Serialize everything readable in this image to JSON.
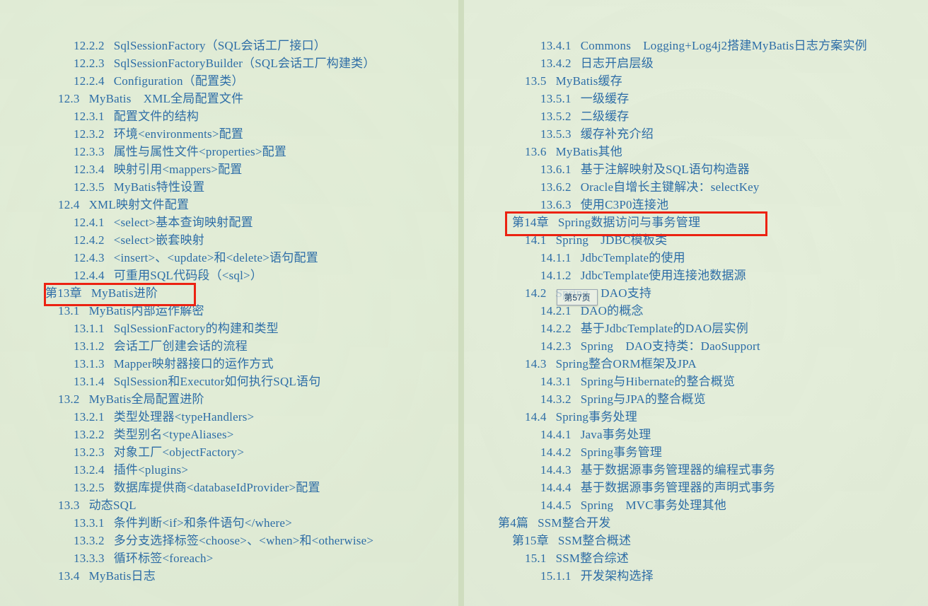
{
  "document": {
    "kind": "book-table-of-contents",
    "language": "zh-CN",
    "background_color": "#e3eed8",
    "text_color": "#2d6ea8",
    "highlight_color": "#ee2211"
  },
  "overlay": {
    "page_tooltip": "第57页"
  },
  "left_page": {
    "entries": [
      {
        "num": "12.2.2",
        "title": "SqlSessionFactory（SQL会话工厂接口）",
        "level": "sub"
      },
      {
        "num": "12.2.3",
        "title": "SqlSessionFactoryBuilder（SQL会话工厂构建类）",
        "level": "sub"
      },
      {
        "num": "12.2.4",
        "title": "Configuration（配置类）",
        "level": "sub"
      },
      {
        "num": "12.3",
        "title": "MyBatis　XML全局配置文件",
        "level": "sec"
      },
      {
        "num": "12.3.1",
        "title": "配置文件的结构",
        "level": "sub"
      },
      {
        "num": "12.3.2",
        "title": "环境<environments>配置",
        "level": "sub"
      },
      {
        "num": "12.3.3",
        "title": "属性与属性文件<properties>配置",
        "level": "sub"
      },
      {
        "num": "12.3.4",
        "title": "映射引用<mappers>配置",
        "level": "sub"
      },
      {
        "num": "12.3.5",
        "title": "MyBatis特性设置",
        "level": "sub"
      },
      {
        "num": "12.4",
        "title": "XML映射文件配置",
        "level": "sec"
      },
      {
        "num": "12.4.1",
        "title": "<select>基本查询映射配置",
        "level": "sub"
      },
      {
        "num": "12.4.2",
        "title": "<select>嵌套映射",
        "level": "sub"
      },
      {
        "num": "12.4.3",
        "title": "<insert>、<update>和<delete>语句配置",
        "level": "sub"
      },
      {
        "num": "12.4.4",
        "title": "可重用SQL代码段（<sql>）",
        "level": "sub"
      },
      {
        "num": "第13章",
        "title": "MyBatis进阶",
        "level": "chap",
        "highlighted": true
      },
      {
        "num": "13.1",
        "title": "MyBatis内部运作解密",
        "level": "sec"
      },
      {
        "num": "13.1.1",
        "title": "SqlSessionFactory的构建和类型",
        "level": "sub"
      },
      {
        "num": "13.1.2",
        "title": "会话工厂创建会话的流程",
        "level": "sub"
      },
      {
        "num": "13.1.3",
        "title": "Mapper映射器接口的运作方式",
        "level": "sub"
      },
      {
        "num": "13.1.4",
        "title": "SqlSession和Executor如何执行SQL语句",
        "level": "sub"
      },
      {
        "num": "13.2",
        "title": "MyBatis全局配置进阶",
        "level": "sec"
      },
      {
        "num": "13.2.1",
        "title": "类型处理器<typeHandlers>",
        "level": "sub"
      },
      {
        "num": "13.2.2",
        "title": "类型别名<typeAliases>",
        "level": "sub"
      },
      {
        "num": "13.2.3",
        "title": "对象工厂<objectFactory>",
        "level": "sub"
      },
      {
        "num": "13.2.4",
        "title": "插件<plugins>",
        "level": "sub"
      },
      {
        "num": "13.2.5",
        "title": "数据库提供商<databaseIdProvider>配置",
        "level": "sub"
      },
      {
        "num": "13.3",
        "title": "动态SQL",
        "level": "sec"
      },
      {
        "num": "13.3.1",
        "title": "条件判断<if>和条件语句</where>",
        "level": "sub"
      },
      {
        "num": "13.3.2",
        "title": "多分支选择标签<choose>、<when>和<otherwise>",
        "level": "sub"
      },
      {
        "num": "13.3.3",
        "title": "循环标签<foreach>",
        "level": "sub"
      },
      {
        "num": "13.4",
        "title": "MyBatis日志",
        "level": "sec"
      }
    ]
  },
  "right_page": {
    "entries": [
      {
        "num": "13.4.1",
        "title": "Commons　Logging+Log4j2搭建MyBatis日志方案实例",
        "level": "sub"
      },
      {
        "num": "13.4.2",
        "title": "日志开启层级",
        "level": "sub"
      },
      {
        "num": "13.5",
        "title": "MyBatis缓存",
        "level": "sec"
      },
      {
        "num": "13.5.1",
        "title": "一级缓存",
        "level": "sub"
      },
      {
        "num": "13.5.2",
        "title": "二级缓存",
        "level": "sub"
      },
      {
        "num": "13.5.3",
        "title": "缓存补充介绍",
        "level": "sub"
      },
      {
        "num": "13.6",
        "title": "MyBatis其他",
        "level": "sec"
      },
      {
        "num": "13.6.1",
        "title": "基于注解映射及SQL语句构造器",
        "level": "sub"
      },
      {
        "num": "13.6.2",
        "title": "Oracle自增长主键解决：selectKey",
        "level": "sub"
      },
      {
        "num": "13.6.3",
        "title": "使用C3P0连接池",
        "level": "sub"
      },
      {
        "num": "第14章",
        "title": "Spring数据访问与事务管理",
        "level": "chap",
        "highlighted": true
      },
      {
        "num": "14.1",
        "title": "Spring　JDBC模板类",
        "level": "sec"
      },
      {
        "num": "14.1.1",
        "title": "JdbcTemplate的使用",
        "level": "sub"
      },
      {
        "num": "14.1.2",
        "title": "JdbcTemplate使用连接池数据源",
        "level": "sub"
      },
      {
        "num": "14.2",
        "title": "Spring　DAO支持",
        "level": "sec"
      },
      {
        "num": "14.2.1",
        "title": "DAO的概念",
        "level": "sub"
      },
      {
        "num": "14.2.2",
        "title": "基于JdbcTemplate的DAO层实例",
        "level": "sub"
      },
      {
        "num": "14.2.3",
        "title": "Spring　DAO支持类：DaoSupport",
        "level": "sub"
      },
      {
        "num": "14.3",
        "title": "Spring整合ORM框架及JPA",
        "level": "sec"
      },
      {
        "num": "14.3.1",
        "title": "Spring与Hibernate的整合概览",
        "level": "sub"
      },
      {
        "num": "14.3.2",
        "title": "Spring与JPA的整合概览",
        "level": "sub"
      },
      {
        "num": "14.4",
        "title": "Spring事务处理",
        "level": "sec"
      },
      {
        "num": "14.4.1",
        "title": "Java事务处理",
        "level": "sub"
      },
      {
        "num": "14.4.2",
        "title": "Spring事务管理",
        "level": "sub"
      },
      {
        "num": "14.4.3",
        "title": "基于数据源事务管理器的编程式事务",
        "level": "sub"
      },
      {
        "num": "14.4.4",
        "title": "基于数据源事务管理器的声明式事务",
        "level": "sub"
      },
      {
        "num": "14.4.5",
        "title": "Spring　MVC事务处理其他",
        "level": "sub"
      },
      {
        "num": "第4篇",
        "title": "SSM整合开发",
        "level": "part"
      },
      {
        "num": "第15章",
        "title": "SSM整合概述",
        "level": "chap"
      },
      {
        "num": "15.1",
        "title": "SSM整合综述",
        "level": "sec"
      },
      {
        "num": "15.1.1",
        "title": "开发架构选择",
        "level": "sub"
      }
    ]
  }
}
